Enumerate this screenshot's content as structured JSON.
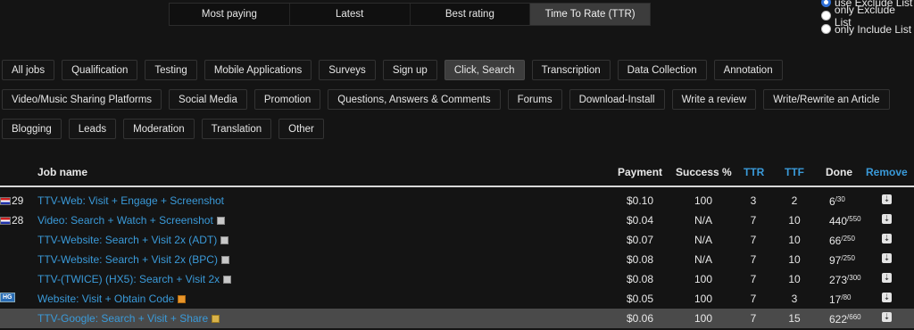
{
  "sort_tabs": [
    {
      "label": "Most paying"
    },
    {
      "label": "Latest"
    },
    {
      "label": "Best rating"
    },
    {
      "label": "Time To Rate (TTR)",
      "active": true
    }
  ],
  "list_filter": [
    {
      "label": "use Exclude List",
      "checked": true
    },
    {
      "label": "only Exclude List",
      "checked": false
    },
    {
      "label": "only Include List",
      "checked": false
    }
  ],
  "categories": [
    [
      "All jobs",
      "Qualification",
      "Testing",
      "Mobile Applications",
      "Surveys",
      "Sign up",
      "Click, Search",
      "Transcription",
      "Data Collection",
      "Annotation"
    ],
    [
      "Video/Music Sharing Platforms",
      "Social Media",
      "Promotion",
      "Questions, Answers & Comments",
      "Forums",
      "Download-Install",
      "Write a review",
      "Write/Rewrite an Article"
    ],
    [
      "Blogging",
      "Leads",
      "Moderation",
      "Translation",
      "Other"
    ]
  ],
  "active_category": "Click, Search",
  "table": {
    "headers": {
      "job": "Job name",
      "payment": "Payment",
      "success": "Success %",
      "ttr": "TTR",
      "ttf": "TTF",
      "done": "Done",
      "remove": "Remove"
    },
    "rows": [
      {
        "badge": "flag",
        "id": "29",
        "name": "TTV-Web: Visit + Engage + Screenshot",
        "icon": "",
        "payment": "$0.10",
        "success": "100",
        "ttr": "3",
        "ttf": "2",
        "done": "6",
        "total": "30"
      },
      {
        "badge": "flag",
        "id": "28",
        "name": "Video: Search + Watch + Screenshot",
        "icon": "grey",
        "payment": "$0.04",
        "success": "N/A",
        "ttr": "7",
        "ttf": "10",
        "done": "440",
        "total": "550"
      },
      {
        "badge": "",
        "id": "",
        "name": "TTV-Website: Search + Visit 2x (ADT)",
        "icon": "grey",
        "payment": "$0.07",
        "success": "N/A",
        "ttr": "7",
        "ttf": "10",
        "done": "66",
        "total": "250"
      },
      {
        "badge": "",
        "id": "",
        "name": "TTV-Website: Search + Visit 2x (BPC)",
        "icon": "grey",
        "payment": "$0.08",
        "success": "N/A",
        "ttr": "7",
        "ttf": "10",
        "done": "97",
        "total": "250"
      },
      {
        "badge": "",
        "id": "",
        "name": "TTV-(TWICE) (HX5): Search + Visit 2x",
        "icon": "grey",
        "payment": "$0.08",
        "success": "100",
        "ttr": "7",
        "ttf": "10",
        "done": "273",
        "total": "300"
      },
      {
        "badge": "hg",
        "id": "",
        "name": "Website: Visit + Obtain Code",
        "icon": "orange",
        "payment": "$0.05",
        "success": "100",
        "ttr": "7",
        "ttf": "3",
        "done": "17",
        "total": "80"
      },
      {
        "badge": "",
        "id": "",
        "name": "TTV-Google: Search + Visit + Share",
        "icon": "gold",
        "payment": "$0.06",
        "success": "100",
        "ttr": "7",
        "ttf": "15",
        "done": "622",
        "total": "660",
        "highlighted": true
      }
    ]
  },
  "badge_text": {
    "hg": "HG"
  },
  "remove_glyph": "⇣",
  "colors": {
    "link": "#3a9ad9",
    "background": "#141414",
    "active_tab": "#3c3c3c"
  }
}
